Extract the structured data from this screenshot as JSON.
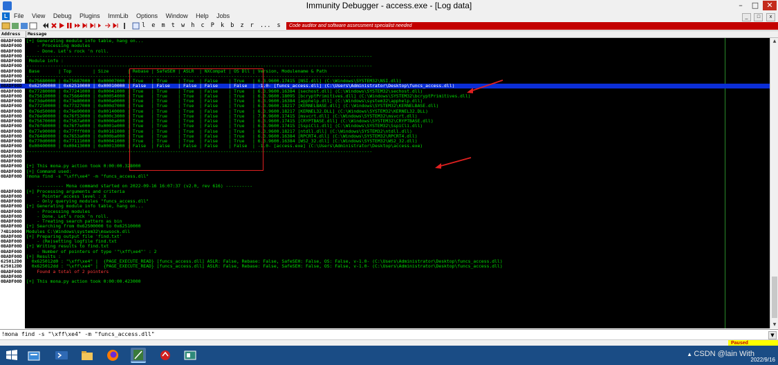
{
  "window": {
    "title": "Immunity Debugger - access.exe - [Log data]",
    "controls": [
      "–",
      "□",
      "✕"
    ]
  },
  "menu": {
    "logo": "L",
    "items": [
      "File",
      "View",
      "Debug",
      "Plugins",
      "ImmLib",
      "Options",
      "Window",
      "Help",
      "Jobs"
    ],
    "right_controls": [
      "_",
      "□",
      "x"
    ]
  },
  "toolbar": {
    "letters": [
      "l",
      "e",
      "m",
      "t",
      "w",
      "h",
      "c",
      "P",
      "k",
      "b",
      "z",
      "r",
      "...",
      "s",
      "?"
    ],
    "tagline": "Code auditor and software assessment specialist needed"
  },
  "log": {
    "columns": [
      "Address",
      "Message"
    ],
    "rows": [
      {
        "addr": "0BADF00D",
        "msg": "[+] Generating module info table, hang on..."
      },
      {
        "addr": "0BADF00D",
        "msg": "    - Processing modules"
      },
      {
        "addr": "0BADF00D",
        "msg": "    - Done. Let's rock 'n roll."
      },
      {
        "addr": "0BADF00D",
        "msg": "----------------------------------------------------------------------------------------------------------------------------------"
      },
      {
        "addr": "0BADF00D",
        "msg": " Module info :"
      },
      {
        "addr": "0BADF00D",
        "msg": "----------------------------------------------------------------------------------------------------------------------------------"
      },
      {
        "addr": "0BADF00D",
        "msg": " Base       | Top        | Size       | Rebase | SafeSEH | ASLR  | NXCompat | OS Dll | Version, Modulename & Path"
      },
      {
        "addr": "0BADF00D",
        "msg": "----------------------------------------------------------------------------------------------------------------------------------"
      },
      {
        "addr": "0BADF00D",
        "msg": " 0x75680000 | 0x75687000 | 0x00007000 | True   | True    | True  | False    | True   | 6.3.9600.17415 [NSI.dll] (C:\\Windows\\SYSTEM32\\NSI.dll)"
      },
      {
        "addr": "0BADF00D",
        "msg": " 0x62500000 | 0x62510000 | 0x00010000 | False  | False   | False | False    | False  | -1.0- [funcs_access.dll] (C:\\Users\\Administrator\\Desktop\\funcs_access.dll)",
        "sel": true
      },
      {
        "addr": "0BADF00D",
        "msg": " 0x77280000 | 0x77241000 | 0x00041000 | True   | True    | True  | False    | True   | 6.3.9600.16384 [sechost.dll] (C:\\Windows\\SYSTEM32\\sechost.dll)"
      },
      {
        "addr": "0BADF00D",
        "msg": " 0x75610000 | 0x75664000 | 0x00054000 | True   | True    | True  | False    | True   | 6.3.9600.18095 [bcryptPrimitives.dll] (C:\\Windows\\SYSTEM32\\bcryptPrimitives.dll)"
      },
      {
        "addr": "0BADF00D",
        "msg": " 0x73de0000 | 0x73e80000 | 0x000a0000 | True   | True    | True  | False    | True   | 6.3.9600.16384 [apphelp.dll] (C:\\Windows\\system32\\apphelp.dll)"
      },
      {
        "addr": "0BADF00D",
        "msg": " 0x77250000 | 0x77327000 | 0x000d7000 | True   | True    | True  | False    | True   | 6.3.9600.18217 [KERNELBASE.dll] (C:\\Windows\\SYSTEM32\\KERNELBASE.dll)"
      },
      {
        "addr": "0BADF00D",
        "msg": " 0x76d50000 | 0x76e90000 | 0x00140000 | True   | True    | True  | False    | True   | 6.3.9600.18217 [KERNEL32.DLL] (C:\\Windows\\SYSTEM32\\KERNEL32.DLL)"
      },
      {
        "addr": "0BADF00D",
        "msg": " 0x76e90000 | 0x76f53000 | 0x000c3000 | True   | True    | True  | False    | True   | 7.0.9600.17415 [msvcrt.dll] (C:\\Windows\\SYSTEM32\\msvcrt.dll)"
      },
      {
        "addr": "0BADF00D",
        "msg": " 0x75670000 | 0x7567a000 | 0x0000a000 | True   | True    | True  | False    | True   | 6.3.9600.17415 [CRYPTBASE.dll] (C:\\Windows\\SYSTEM32\\CRYPTBASE.dll)"
      },
      {
        "addr": "0BADF00D",
        "msg": " 0x76f60000 | 0x76f7e000 | 0x0001e000 | True   | True    | True  | False    | True   | 6.3.9600.17415 [SspiCli.dll] (C:\\Windows\\SYSTEM32\\SspiCli.dll)"
      },
      {
        "addr": "0BADF00D",
        "msg": " 0x77e90000 | 0x77fff000 | 0x00161000 | True   | True    | True  | False    | True   | 6.3.9600.18217 [ntdll.dll] (C:\\Windows\\SYSTEM32\\ntdll.dll)"
      },
      {
        "addr": "0BADF00D",
        "msg": " 0x76480000 | 0x7653a000 | 0x000ba000 | True   | True    | True  | False    | True   | 6.3.9600.16384 [RPCRT4.dll] (C:\\Windows\\SYSTEM32\\RPCRT4.dll)"
      },
      {
        "addr": "0BADF00D",
        "msg": " 0x770d0000 | 0x77111000 | 0x00041000 | True   | True    | True  | False    | True   | 6.3.9600.16384 [WS2_32.dll] (C:\\Windows\\SYSTEM32\\WS2_32.dll)"
      },
      {
        "addr": "0BADF00D",
        "msg": " 0x00400000 | 0x00413000 | 0x00013000 | False  | False   | False | False    | False  | -1.0- [access.exe] (C:\\Users\\Administrator\\Desktop\\access.exe)"
      },
      {
        "addr": "0BADF00D",
        "msg": "----------------------------------------------------------------------------------------------------------------------------------"
      },
      {
        "addr": "0BADF00D",
        "msg": ""
      },
      {
        "addr": "0BADF00D",
        "msg": ""
      },
      {
        "addr": "0BADF00D",
        "msg": "[+] This mona.py action took 0:00:00.328000"
      },
      {
        "addr": "0BADF00D",
        "msg": "[+] Command used:"
      },
      {
        "addr": "0BADF00D",
        "msg": "!mona find -s \"\\xff\\xe4\" -m \"funcs_access.dll\""
      },
      {
        "addr": "",
        "msg": ""
      },
      {
        "addr": "",
        "msg": "    ---------- Mona command started on 2022-09-16 16:07:37 (v2.0, rev 616) ----------"
      },
      {
        "addr": "0BADF00D",
        "msg": "[+] Processing arguments and criteria"
      },
      {
        "addr": "0BADF00D",
        "msg": "    - Pointer access level : X"
      },
      {
        "addr": "0BADF00D",
        "msg": "    - Only querying modules \"funcs_access.dll\""
      },
      {
        "addr": "0BADF00D",
        "msg": "[+] Generating module info table, hang on..."
      },
      {
        "addr": "0BADF00D",
        "msg": "    - Processing modules"
      },
      {
        "addr": "0BADF00D",
        "msg": "    - Done. Let's rock 'n roll."
      },
      {
        "addr": "0BADF00D",
        "msg": "    - Treating search pattern as bin"
      },
      {
        "addr": "0BADF00D",
        "msg": "[+] Searching from 0x62500000 to 0x62510000"
      },
      {
        "addr": "74B10000",
        "msg": "Modules C:\\Windows\\system32\\mswsock.dll"
      },
      {
        "addr": "0BADF00D",
        "msg": "[+] Preparing output file 'find.txt'"
      },
      {
        "addr": "0BADF00D",
        "msg": "    - (Re)setting logfile find.txt"
      },
      {
        "addr": "0BADF00D",
        "msg": "[+] Writing results to find.txt"
      },
      {
        "addr": "0BADF00D",
        "msg": "    - Number of pointers of type '\"\\xff\\xe4\"' : 2"
      },
      {
        "addr": "0BADF00D",
        "msg": "[+] Results :"
      },
      {
        "addr": "625012D0",
        "msg": "  0x625012d0 : \"\\xff\\xe4\" |  {PAGE_EXECUTE_READ} [funcs_access.dll] ASLR: False, Rebase: False, SafeSEH: False, OS: False, v-1.0- (C:\\Users\\Administrator\\Desktop\\funcs_access.dll)"
      },
      {
        "addr": "625012DD",
        "msg": "  0x625012dd : \"\\xff\\xe4\" |  {PAGE_EXECUTE_READ} [funcs_access.dll] ASLR: False, Rebase: False, SafeSEH: False, OS: False, v-1.0- (C:\\Users\\Administrator\\Desktop\\funcs_access.dll)"
      },
      {
        "addr": "0BADF00D",
        "msg": "    Found a total of 2 pointers",
        "red": true
      },
      {
        "addr": "0BADF00D",
        "msg": ""
      },
      {
        "addr": "0BADF00D",
        "msg": "[+] This mona.py action took 0:00:00.423000"
      }
    ]
  },
  "command": {
    "value": "!mona find -s \"\\xff\\xe4\" -m \"funcs_access.dll\""
  },
  "status": {
    "state": "Paused"
  },
  "taskbar": {
    "watermark": "CSDN @lain With",
    "date": "2022/9/16"
  },
  "colors": {
    "log_bg": "#000000",
    "log_text": "#00e000",
    "selection": "#0b2ed6",
    "highlight_box": "#e02020",
    "tagline_bg": "#c30000",
    "paused_bg": "#ffff00",
    "taskbar_bg": "#1a4c85"
  }
}
